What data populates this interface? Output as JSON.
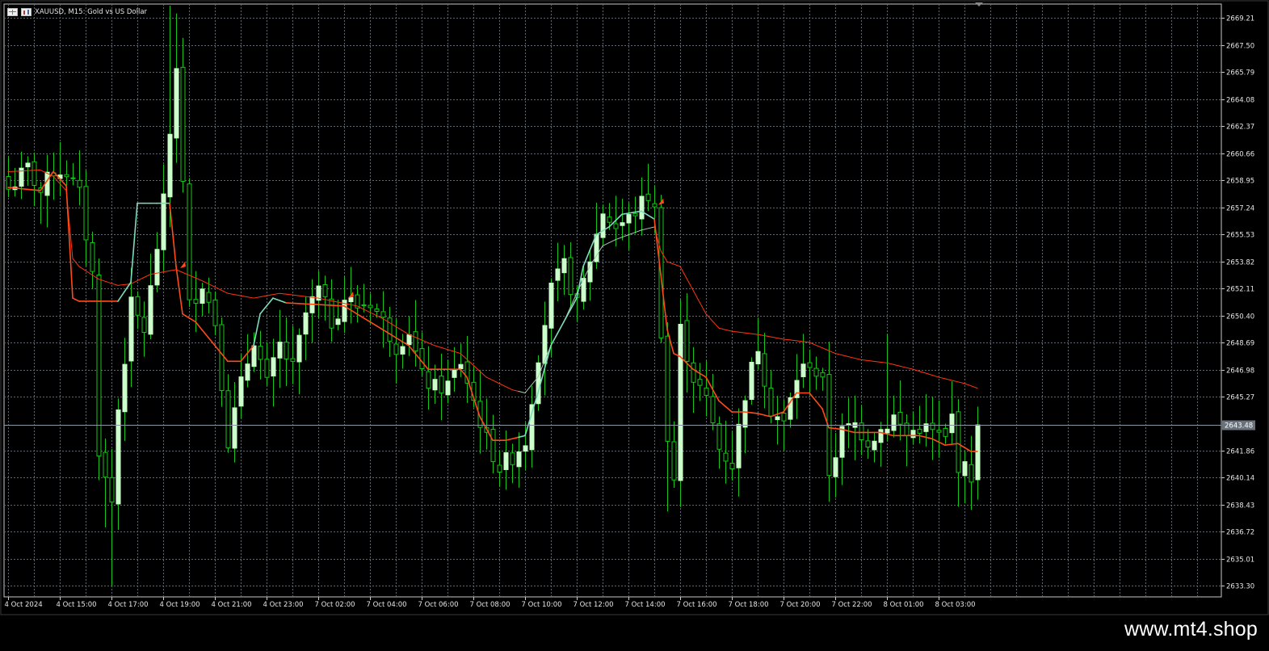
{
  "window": {
    "symbol_title": "XAUUSD, M15:  Gold vs US Dollar",
    "watermark": "www.mt4.shop"
  },
  "colors": {
    "background": "#000000",
    "grid": "#5e6670",
    "frame": "#c8c8c8",
    "bull_body": "#ccffcc",
    "bear_body": "#000000",
    "wick": "#18c41a",
    "fast_ma": "#ff4a1a",
    "fast_ma_up": "#7ddcbc",
    "slow_ma": "#ff3510",
    "slow_ma_up": "#a8c8b8",
    "price_line": "#8d97a3",
    "axis_text": "#e6e6e6"
  },
  "chart_data": {
    "type": "candlestick",
    "timeframe": "M15",
    "y_ticks": [
      "2669.21",
      "2667.50",
      "2665.79",
      "2664.08",
      "2662.37",
      "2660.66",
      "2658.95",
      "2657.24",
      "2655.53",
      "2653.82",
      "2652.11",
      "2650.40",
      "2648.69",
      "2646.98",
      "2645.27",
      "2643.48",
      "2641.86",
      "2640.14",
      "2638.43",
      "2636.72",
      "2635.01",
      "2633.30"
    ],
    "ylim": [
      2632.6,
      2670.1
    ],
    "x_ticks": [
      "4 Oct 2024",
      "4 Oct 15:00",
      "4 Oct 17:00",
      "4 Oct 19:00",
      "4 Oct 21:00",
      "4 Oct 23:00",
      "7 Oct 02:00",
      "7 Oct 04:00",
      "7 Oct 06:00",
      "7 Oct 08:00",
      "7 Oct 10:00",
      "7 Oct 12:00",
      "7 Oct 14:00",
      "7 Oct 16:00",
      "7 Oct 18:00",
      "7 Oct 20:00",
      "7 Oct 22:00",
      "8 Oct 01:00",
      "8 Oct 03:00"
    ],
    "bars_per_tick": 8,
    "current_price": "2643.48",
    "current_price_value": 2643.48,
    "anchors": [
      {
        "i": 0,
        "c": 2658.4
      },
      {
        "i": 3,
        "c": 2659.7
      },
      {
        "i": 5,
        "c": 2658.2
      },
      {
        "i": 7,
        "c": 2659.6
      },
      {
        "i": 9,
        "c": 2659.5
      },
      {
        "i": 11,
        "c": 2658.0
      },
      {
        "i": 13,
        "c": 2653.0
      },
      {
        "i": 14,
        "c": 2642.0
      },
      {
        "i": 15,
        "c": 2640.0
      },
      {
        "i": 16,
        "c": 2638.6
      },
      {
        "i": 17,
        "c": 2644.5
      },
      {
        "i": 19,
        "c": 2651.0
      },
      {
        "i": 21,
        "c": 2649.5
      },
      {
        "i": 22,
        "c": 2652.0
      },
      {
        "i": 24,
        "c": 2657.5
      },
      {
        "i": 26,
        "c": 2666.3
      },
      {
        "i": 28,
        "c": 2651.0
      },
      {
        "i": 30,
        "c": 2652.5
      },
      {
        "i": 32,
        "c": 2650.0
      },
      {
        "i": 34,
        "c": 2642.5
      },
      {
        "i": 36,
        "c": 2646.0
      },
      {
        "i": 38,
        "c": 2649.0
      },
      {
        "i": 40,
        "c": 2646.0
      },
      {
        "i": 42,
        "c": 2648.5
      },
      {
        "i": 44,
        "c": 2647.0
      },
      {
        "i": 46,
        "c": 2650.5
      },
      {
        "i": 48,
        "c": 2652.0
      },
      {
        "i": 50,
        "c": 2650.0
      },
      {
        "i": 52,
        "c": 2651.5
      },
      {
        "i": 54,
        "c": 2651.0
      },
      {
        "i": 56,
        "c": 2651.3
      },
      {
        "i": 58,
        "c": 2650.0
      },
      {
        "i": 60,
        "c": 2648.5
      },
      {
        "i": 62,
        "c": 2649.5
      },
      {
        "i": 64,
        "c": 2646.5
      },
      {
        "i": 66,
        "c": 2645.8
      },
      {
        "i": 68,
        "c": 2646.0
      },
      {
        "i": 70,
        "c": 2647.5
      },
      {
        "i": 72,
        "c": 2645.0
      },
      {
        "i": 74,
        "c": 2642.5
      },
      {
        "i": 76,
        "c": 2640.8
      },
      {
        "i": 78,
        "c": 2641.5
      },
      {
        "i": 80,
        "c": 2642.5
      },
      {
        "i": 82,
        "c": 2648.0
      },
      {
        "i": 84,
        "c": 2652.0
      },
      {
        "i": 86,
        "c": 2653.5
      },
      {
        "i": 88,
        "c": 2651.0
      },
      {
        "i": 90,
        "c": 2654.0
      },
      {
        "i": 92,
        "c": 2657.0
      },
      {
        "i": 94,
        "c": 2656.0
      },
      {
        "i": 96,
        "c": 2656.5
      },
      {
        "i": 98,
        "c": 2657.5
      },
      {
        "i": 99,
        "c": 2658.0
      },
      {
        "i": 100,
        "c": 2657.0
      },
      {
        "i": 101,
        "c": 2649.5
      },
      {
        "i": 102,
        "c": 2642.5
      },
      {
        "i": 103,
        "c": 2640.0
      },
      {
        "i": 104,
        "c": 2649.5
      },
      {
        "i": 106,
        "c": 2646.5
      },
      {
        "i": 108,
        "c": 2645.0
      },
      {
        "i": 110,
        "c": 2642.0
      },
      {
        "i": 112,
        "c": 2641.0
      },
      {
        "i": 114,
        "c": 2645.5
      },
      {
        "i": 116,
        "c": 2648.5
      },
      {
        "i": 118,
        "c": 2644.5
      },
      {
        "i": 120,
        "c": 2643.5
      },
      {
        "i": 122,
        "c": 2646.5
      },
      {
        "i": 124,
        "c": 2647.5
      },
      {
        "i": 126,
        "c": 2646.0
      },
      {
        "i": 127,
        "c": 2640.5
      },
      {
        "i": 129,
        "c": 2643.0
      },
      {
        "i": 131,
        "c": 2643.5
      },
      {
        "i": 133,
        "c": 2642.5
      },
      {
        "i": 135,
        "c": 2643.2
      },
      {
        "i": 137,
        "c": 2644.0
      },
      {
        "i": 139,
        "c": 2642.8
      },
      {
        "i": 141,
        "c": 2643.4
      },
      {
        "i": 143,
        "c": 2643.0
      },
      {
        "i": 145,
        "c": 2642.5
      },
      {
        "i": 146,
        "c": 2644.0
      },
      {
        "i": 147,
        "c": 2641.0
      },
      {
        "i": 149,
        "c": 2640.3
      },
      {
        "i": 150,
        "c": 2643.48
      }
    ],
    "fast_ma": {
      "period_hint": "short",
      "points": [
        {
          "i": 0,
          "v": 2658.5
        },
        {
          "i": 5,
          "v": 2658.3
        },
        {
          "i": 7,
          "v": 2659.5
        },
        {
          "i": 9,
          "v": 2658.6
        },
        {
          "i": 10,
          "v": 2651.5
        },
        {
          "i": 11,
          "v": 2651.3
        },
        {
          "i": 17,
          "v": 2651.3
        },
        {
          "i": 19,
          "v": 2652.5
        },
        {
          "i": 20,
          "v": 2657.5
        },
        {
          "i": 25,
          "v": 2657.5
        },
        {
          "i": 26,
          "v": 2653.5
        },
        {
          "i": 27,
          "v": 2650.5
        },
        {
          "i": 29,
          "v": 2650.0
        },
        {
          "i": 31,
          "v": 2649.0
        },
        {
          "i": 34,
          "v": 2647.5
        },
        {
          "i": 36,
          "v": 2647.5
        },
        {
          "i": 38,
          "v": 2648.5
        },
        {
          "i": 39,
          "v": 2650.5
        },
        {
          "i": 41,
          "v": 2651.5
        },
        {
          "i": 43,
          "v": 2651.2
        },
        {
          "i": 52,
          "v": 2651.0
        },
        {
          "i": 54,
          "v": 2650.5
        },
        {
          "i": 56,
          "v": 2650.0
        },
        {
          "i": 58,
          "v": 2649.5
        },
        {
          "i": 62,
          "v": 2648.5
        },
        {
          "i": 65,
          "v": 2647.0
        },
        {
          "i": 70,
          "v": 2647.0
        },
        {
          "i": 71,
          "v": 2646.5
        },
        {
          "i": 73,
          "v": 2644.0
        },
        {
          "i": 75,
          "v": 2642.5
        },
        {
          "i": 77,
          "v": 2642.5
        },
        {
          "i": 80,
          "v": 2642.8
        },
        {
          "i": 82,
          "v": 2645.5
        },
        {
          "i": 84,
          "v": 2648.5
        },
        {
          "i": 86,
          "v": 2650.0
        },
        {
          "i": 88,
          "v": 2651.5
        },
        {
          "i": 89,
          "v": 2653.5
        },
        {
          "i": 91,
          "v": 2655.5
        },
        {
          "i": 93,
          "v": 2656.0
        },
        {
          "i": 95,
          "v": 2656.8
        },
        {
          "i": 98,
          "v": 2657.0
        },
        {
          "i": 100,
          "v": 2656.5
        },
        {
          "i": 102,
          "v": 2649.5
        },
        {
          "i": 103,
          "v": 2648.0
        },
        {
          "i": 104,
          "v": 2647.8
        },
        {
          "i": 106,
          "v": 2647.0
        },
        {
          "i": 108,
          "v": 2646.5
        },
        {
          "i": 110,
          "v": 2645.0
        },
        {
          "i": 112,
          "v": 2644.3
        },
        {
          "i": 114,
          "v": 2644.3
        },
        {
          "i": 116,
          "v": 2644.2
        },
        {
          "i": 118,
          "v": 2644.0
        },
        {
          "i": 120,
          "v": 2644.3
        },
        {
          "i": 122,
          "v": 2645.5
        },
        {
          "i": 124,
          "v": 2645.5
        },
        {
          "i": 126,
          "v": 2644.5
        },
        {
          "i": 127,
          "v": 2643.3
        },
        {
          "i": 129,
          "v": 2643.2
        },
        {
          "i": 131,
          "v": 2643.0
        },
        {
          "i": 135,
          "v": 2643.0
        },
        {
          "i": 137,
          "v": 2642.8
        },
        {
          "i": 139,
          "v": 2642.8
        },
        {
          "i": 141,
          "v": 2642.8
        },
        {
          "i": 143,
          "v": 2642.6
        },
        {
          "i": 145,
          "v": 2642.2
        },
        {
          "i": 147,
          "v": 2642.3
        },
        {
          "i": 149,
          "v": 2641.8
        },
        {
          "i": 150,
          "v": 2641.8
        }
      ],
      "up_segments": [
        [
          17,
          25
        ],
        [
          38,
          43
        ],
        [
          79,
          100
        ]
      ]
    },
    "slow_ma": {
      "period_hint": "long",
      "points": [
        {
          "i": 0,
          "v": 2659.5
        },
        {
          "i": 5,
          "v": 2659.6
        },
        {
          "i": 7,
          "v": 2659.2
        },
        {
          "i": 9,
          "v": 2658.3
        },
        {
          "i": 10,
          "v": 2654.0
        },
        {
          "i": 11,
          "v": 2653.5
        },
        {
          "i": 14,
          "v": 2652.7
        },
        {
          "i": 17,
          "v": 2652.3
        },
        {
          "i": 19,
          "v": 2652.4
        },
        {
          "i": 22,
          "v": 2653.0
        },
        {
          "i": 26,
          "v": 2653.3
        },
        {
          "i": 30,
          "v": 2652.6
        },
        {
          "i": 34,
          "v": 2651.8
        },
        {
          "i": 38,
          "v": 2651.5
        },
        {
          "i": 42,
          "v": 2651.8
        },
        {
          "i": 48,
          "v": 2651.5
        },
        {
          "i": 54,
          "v": 2651.0
        },
        {
          "i": 58,
          "v": 2650.2
        },
        {
          "i": 62,
          "v": 2649.2
        },
        {
          "i": 66,
          "v": 2648.5
        },
        {
          "i": 70,
          "v": 2648.0
        },
        {
          "i": 74,
          "v": 2646.5
        },
        {
          "i": 78,
          "v": 2645.7
        },
        {
          "i": 80,
          "v": 2645.5
        },
        {
          "i": 82,
          "v": 2646.5
        },
        {
          "i": 84,
          "v": 2648.5
        },
        {
          "i": 86,
          "v": 2650.0
        },
        {
          "i": 88,
          "v": 2651.8
        },
        {
          "i": 90,
          "v": 2653.5
        },
        {
          "i": 92,
          "v": 2654.8
        },
        {
          "i": 94,
          "v": 2655.2
        },
        {
          "i": 96,
          "v": 2655.5
        },
        {
          "i": 98,
          "v": 2655.8
        },
        {
          "i": 100,
          "v": 2656.0
        },
        {
          "i": 101,
          "v": 2654.5
        },
        {
          "i": 102,
          "v": 2653.8
        },
        {
          "i": 104,
          "v": 2653.5
        },
        {
          "i": 106,
          "v": 2652.0
        },
        {
          "i": 108,
          "v": 2650.5
        },
        {
          "i": 110,
          "v": 2649.6
        },
        {
          "i": 112,
          "v": 2649.4
        },
        {
          "i": 116,
          "v": 2649.2
        },
        {
          "i": 120,
          "v": 2648.9
        },
        {
          "i": 124,
          "v": 2648.7
        },
        {
          "i": 128,
          "v": 2648.0
        },
        {
          "i": 132,
          "v": 2647.6
        },
        {
          "i": 136,
          "v": 2647.4
        },
        {
          "i": 140,
          "v": 2647.0
        },
        {
          "i": 144,
          "v": 2646.5
        },
        {
          "i": 148,
          "v": 2646.1
        },
        {
          "i": 150,
          "v": 2645.8
        }
      ],
      "up_segments": [
        [
          79,
          100
        ]
      ]
    },
    "signal_markers": [
      {
        "i": 27,
        "price": 2653.6
      },
      {
        "i": 53,
        "price": 2651.7
      },
      {
        "i": 101,
        "price": 2657.6
      }
    ],
    "grid": true
  }
}
